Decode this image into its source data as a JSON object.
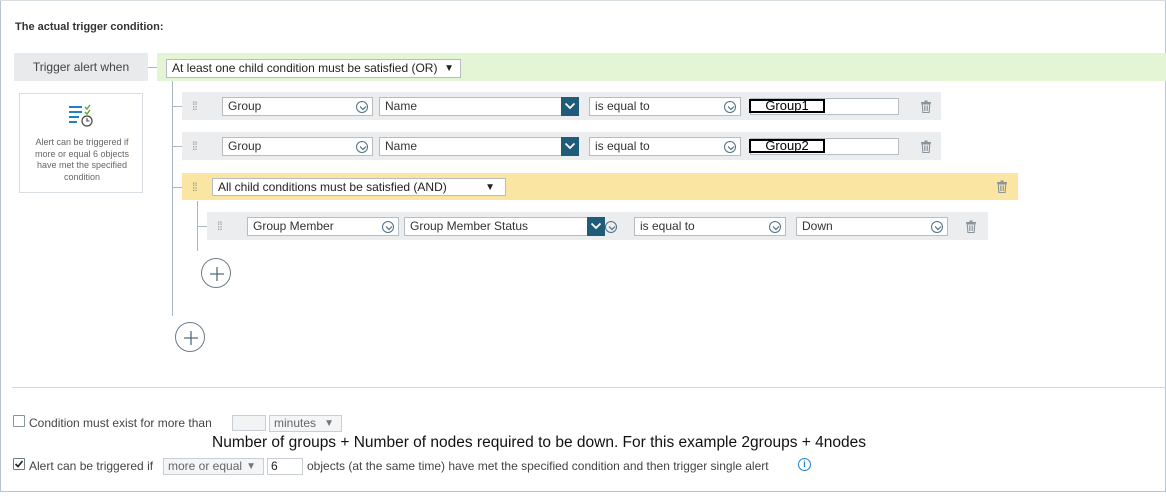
{
  "section_title": "The actual trigger condition:",
  "trigger_label": "Trigger alert when",
  "root_operator": "At least one child condition must be satisfied (OR)",
  "info_box": {
    "icon": "condition-list-clock-icon",
    "text": "Alert can be triggered if more or equal 6 objects have met the specified condition"
  },
  "conditions": [
    {
      "object": "Group",
      "field": "Name",
      "operator": "is equal to",
      "value": "Group1"
    },
    {
      "object": "Group",
      "field": "Name",
      "operator": "is equal to",
      "value": "Group2"
    }
  ],
  "and_group": {
    "operator": "All child conditions must be satisfied (AND)",
    "condition": {
      "object": "Group Member",
      "field": "Group Member Status",
      "operator": "is equal to",
      "value": "Down"
    }
  },
  "footer": {
    "condition_exist_label": "Condition must exist for more than",
    "condition_exist_value": "",
    "condition_exist_unit": "minutes",
    "alert_prefix": "Alert can be triggered if",
    "alert_mode": "more or equal",
    "alert_count": "6",
    "alert_suffix": "objects (at the same time) have met the specified condition and then trigger single alert",
    "condition_exist_checked": false,
    "alert_checked": true
  },
  "annotation": "Number of groups + Number of nodes required to be down. For this example 2groups + 4nodes",
  "colors": {
    "or_band": "#e3f5d4",
    "and_band": "#fbe5a3",
    "row_band": "#ebedef",
    "teal": "#1e5c7a",
    "info_blue": "#1f7fc7"
  }
}
